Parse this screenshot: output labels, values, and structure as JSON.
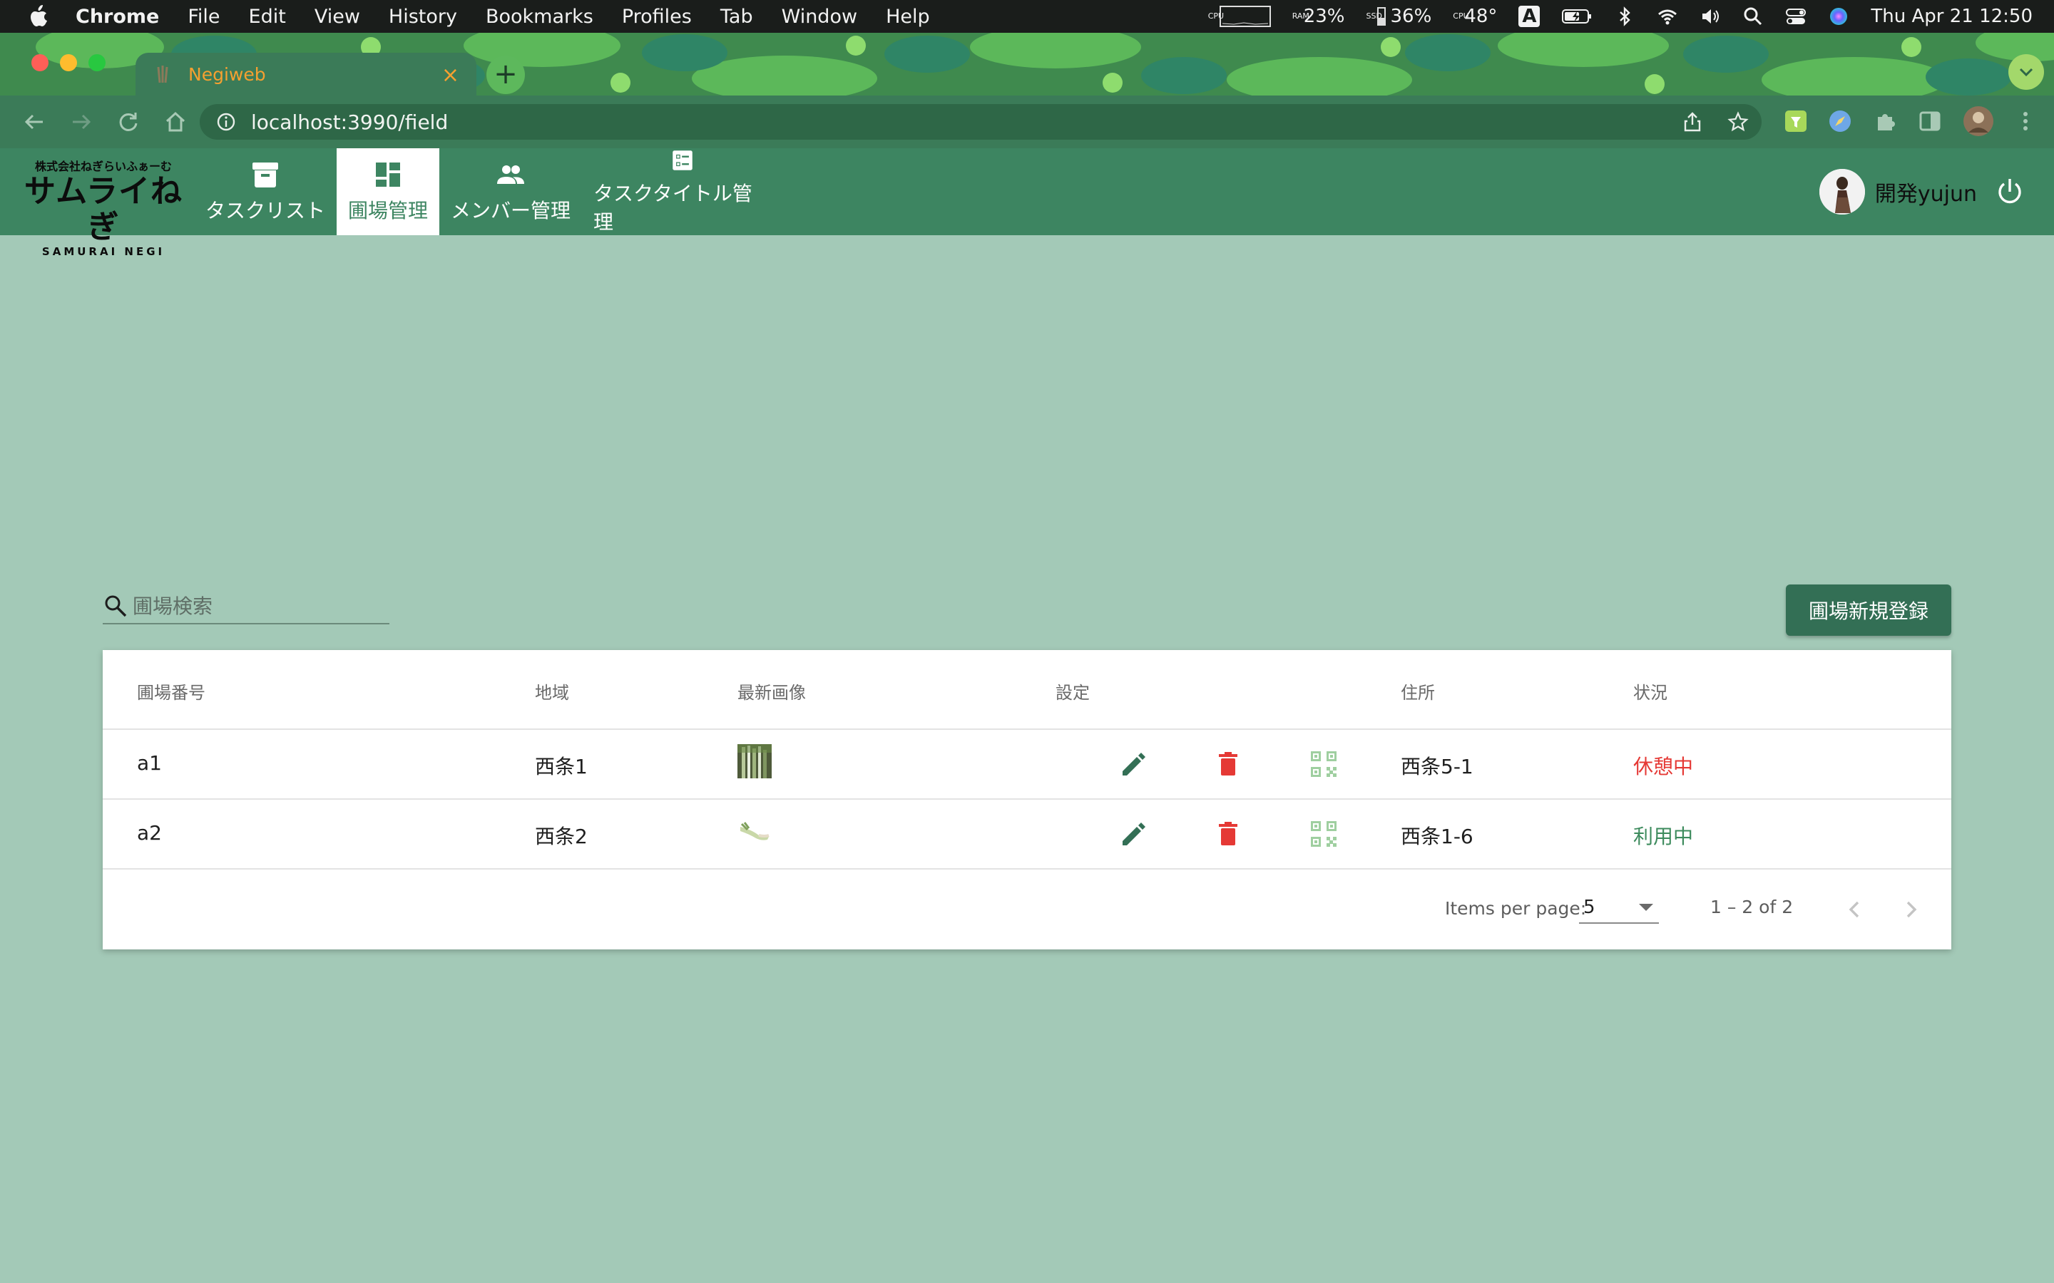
{
  "menubar": {
    "app_name": "Chrome",
    "items": [
      "File",
      "Edit",
      "View",
      "History",
      "Bookmarks",
      "Profiles",
      "Tab",
      "Window",
      "Help"
    ],
    "cpu_label": "CPU",
    "ram_label": "RAM",
    "ram_value": "23%",
    "ssd_label": "SSD",
    "ssd_value": "36%",
    "cpu_temp_label": "CPU",
    "cpu_temp_value": "48°",
    "input_source": "A",
    "datetime": "Thu Apr 21  12:50"
  },
  "browser": {
    "tab_title": "Negiweb",
    "tab_close": "×",
    "new_tab": "+",
    "url": "localhost:3990/field"
  },
  "app": {
    "logo": {
      "company": "株式会社ねぎらいふぁーむ",
      "name": "サムライねぎ",
      "romaji": "SAMURAI NEGI"
    },
    "nav": [
      {
        "label": "タスクリスト",
        "icon": "archive-icon"
      },
      {
        "label": "圃場管理",
        "icon": "dashboard-icon",
        "active": true
      },
      {
        "label": "メンバー管理",
        "icon": "people-icon"
      },
      {
        "label": "タスクタイトル管理",
        "icon": "list-alt-icon"
      }
    ],
    "user_name": "開発yujun"
  },
  "search": {
    "placeholder": "圃場検索",
    "value": ""
  },
  "add_button": "圃場新規登録",
  "table": {
    "columns": [
      "圃場番号",
      "地域",
      "最新画像",
      "設定",
      "住所",
      "状況"
    ],
    "rows": [
      {
        "number": "a1",
        "region": "西条1",
        "address": "西条5-1",
        "status": "休憩中",
        "status_color": "#e53935"
      },
      {
        "number": "a2",
        "region": "西条2",
        "address": "西条1-6",
        "status": "利用中",
        "status_color": "#3d8b5d"
      }
    ],
    "paginator": {
      "items_per_page_label": "Items per page:",
      "items_per_page": "5",
      "range": "1 – 2 of 2"
    }
  },
  "colors": {
    "appbar": "#3d8561",
    "background": "#a3c9b7",
    "button": "#336f55",
    "edit_icon": "#336f55",
    "delete_icon": "#e53935",
    "qr_icon": "#9fcfa0"
  }
}
